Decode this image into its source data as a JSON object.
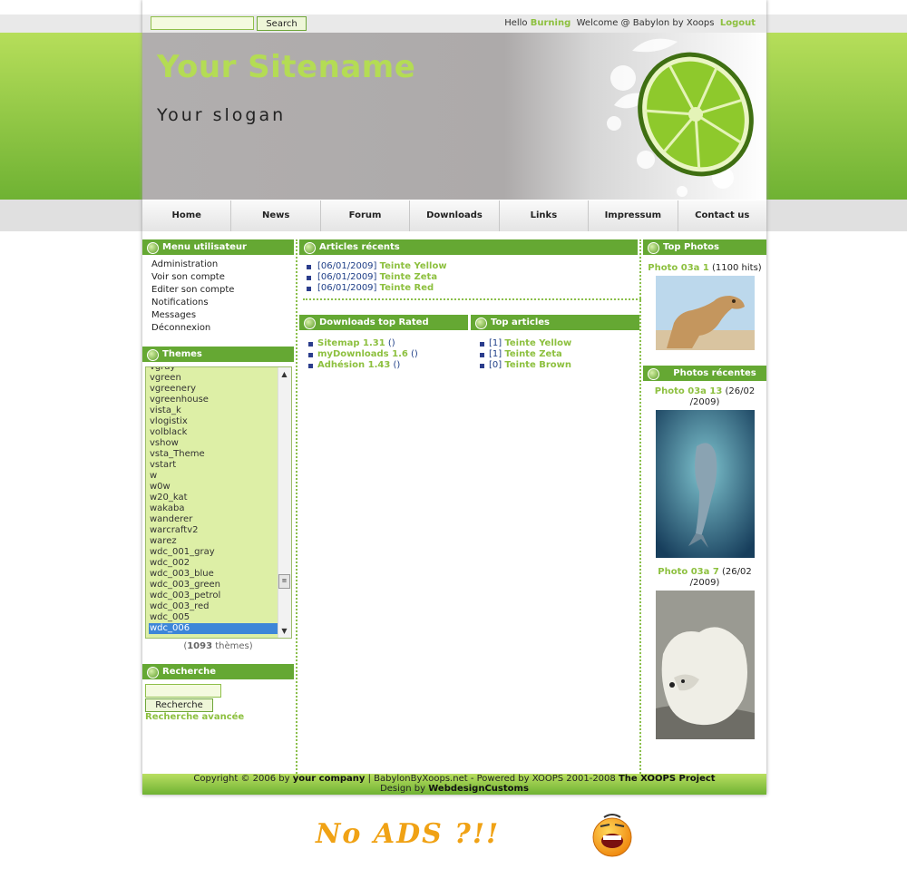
{
  "topbar": {
    "search_button": "Search",
    "hello": "Hello",
    "username": "Burning",
    "welcome": "Welcome @ Babylon by Xoops",
    "logout": "Logout"
  },
  "header": {
    "sitename": "Your Sitename",
    "slogan": "Your slogan"
  },
  "nav": [
    "Home",
    "News",
    "Forum",
    "Downloads",
    "Links",
    "Impressum",
    "Contact us"
  ],
  "menu_user": {
    "title": "Menu utilisateur",
    "items": [
      "Administration",
      "Voir son compte",
      "Editer son compte",
      "Notifications",
      "Messages",
      "Déconnexion"
    ]
  },
  "themes": {
    "title": "Themes",
    "items": [
      "vgray",
      "vgreen",
      "vgreenery",
      "vgreenhouse",
      "vista_k",
      "vlogistix",
      "volblack",
      "vshow",
      "vsta_Theme",
      "vstart",
      "w",
      "w0w",
      "w20_kat",
      "wakaba",
      "wanderer",
      "warcraftv2",
      "warez",
      "wdc_001_gray",
      "wdc_002",
      "wdc_003_blue",
      "wdc_003_green",
      "wdc_003_petrol",
      "wdc_003_red",
      "wdc_005",
      "wdc_006"
    ],
    "selected": "wdc_006",
    "count": "1093",
    "count_label": "thèmes"
  },
  "recherche": {
    "title": "Recherche",
    "button": "Recherche",
    "advanced": "Recherche avancée"
  },
  "articles_recents": {
    "title": "Articles récents",
    "items": [
      {
        "date": "[06/01/2009]",
        "title": "Teinte Yellow"
      },
      {
        "date": "[06/01/2009]",
        "title": "Teinte Zeta"
      },
      {
        "date": "[06/01/2009]",
        "title": "Teinte Red"
      }
    ]
  },
  "downloads_top": {
    "title": "Downloads top Rated",
    "items": [
      {
        "name": "Sitemap 1.31",
        "extra": "()"
      },
      {
        "name": "myDownloads 1.6",
        "extra": "()"
      },
      {
        "name": "Adhésion 1.43",
        "extra": "()"
      }
    ]
  },
  "top_articles": {
    "title": "Top articles",
    "items": [
      {
        "count": "[1]",
        "title": "Teinte Yellow"
      },
      {
        "count": "[1]",
        "title": "Teinte Zeta"
      },
      {
        "count": "[0]",
        "title": "Teinte Brown"
      }
    ]
  },
  "top_photos": {
    "title": "Top Photos",
    "items": [
      {
        "name": "Photo 03a 1",
        "info": "(1100 hits)"
      }
    ]
  },
  "recent_photos": {
    "title": "Photos récentes",
    "items": [
      {
        "name": "Photo 03a 13",
        "info": "(26/02 /2009)"
      },
      {
        "name": "Photo 03a 7",
        "info": "(26/02 /2009)"
      }
    ]
  },
  "footer": {
    "copyright": "Copyright © 2006 by",
    "company": "your company",
    "powered": "|  BabylonByXoops.net - Powered by XOOPS 2001-2008",
    "project": "The XOOPS Project",
    "design_by": "Design by",
    "designer": "WebdesignCustoms"
  },
  "noads": "No ADS ?!!",
  "colors": {
    "accent": "#8dc03f",
    "block_header": "#65a833",
    "link_blue": "#1f3f88"
  }
}
